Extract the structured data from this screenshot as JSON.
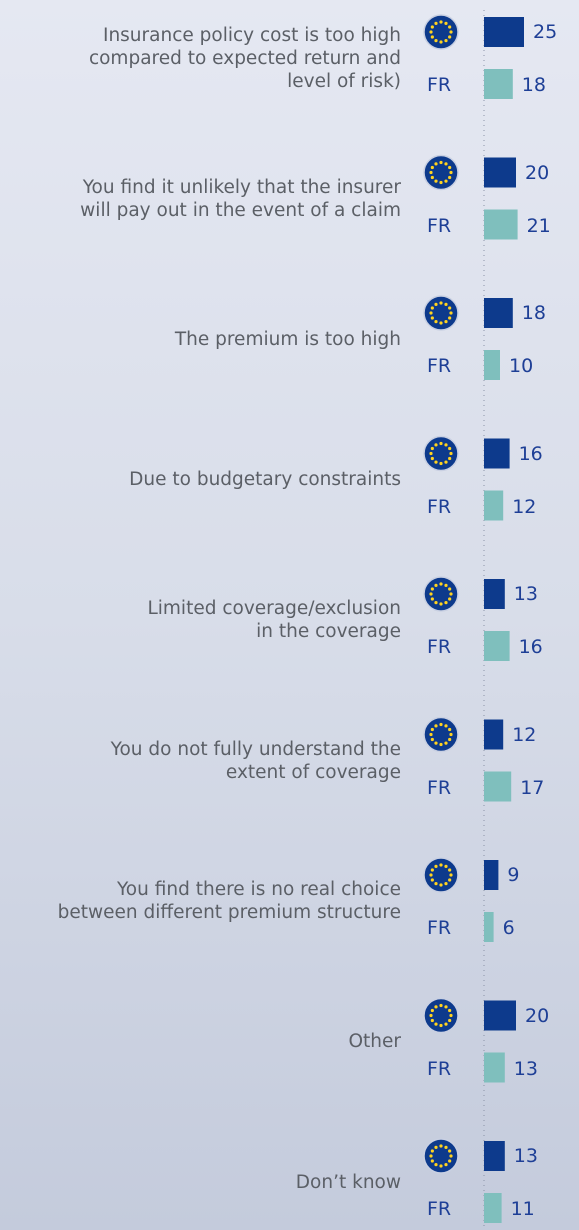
{
  "chart_data": {
    "type": "bar",
    "orientation": "horizontal",
    "categories": [
      "Insurance policy cost is too high compared to expected return and level of risk)",
      "You find it unlikely that the insurer will pay out in the event of a claim",
      "The premium is too high",
      "Due to budgetary constraints",
      "Limited coverage/exclusion in the coverage",
      "You do not fully understand the extent of coverage",
      "You find there is no real choice between different premium structure",
      "Other",
      "Don’t know"
    ],
    "category_lines": [
      [
        "Insurance policy cost is too high",
        "compared to expected return and",
        "level of risk)"
      ],
      [
        "You find it unlikely that the insurer",
        "will pay out in the event of a claim"
      ],
      [
        "The premium is too high"
      ],
      [
        "Due to budgetary constraints"
      ],
      [
        "Limited coverage/exclusion",
        "in the coverage"
      ],
      [
        "You do not fully understand the",
        "extent of coverage"
      ],
      [
        "You find there is no real choice",
        "between different premium structure"
      ],
      [
        "Other"
      ],
      [
        "Don’t know"
      ]
    ],
    "series": [
      {
        "name": "",
        "marker": "eu-flag-icon",
        "color": "#0d3a8c",
        "values": [
          25,
          20,
          18,
          16,
          13,
          12,
          9,
          20,
          13
        ]
      },
      {
        "name": "FR",
        "color": "#7fbfbd",
        "values": [
          18,
          21,
          10,
          12,
          16,
          17,
          6,
          13,
          11
        ]
      }
    ],
    "xlim": [
      0,
      25
    ],
    "grid": false,
    "legend": "none"
  }
}
